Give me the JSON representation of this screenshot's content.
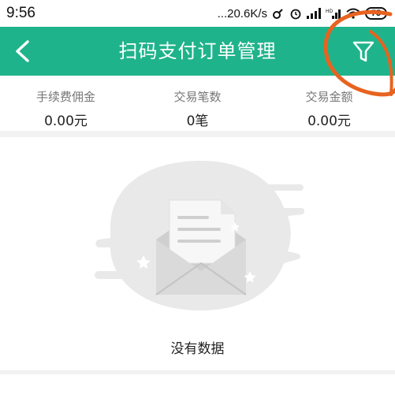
{
  "status_bar": {
    "time": "9:56",
    "network_speed": "...20.6K/s",
    "battery": "75"
  },
  "header": {
    "title": "扫码支付订单管理",
    "back_icon": "chevron-left-icon",
    "filter_icon": "filter-funnel-icon"
  },
  "stats": [
    {
      "label": "手续费佣金",
      "value": "0.00元"
    },
    {
      "label": "交易笔数",
      "value": "0笔"
    },
    {
      "label": "交易金额",
      "value": "0.00元"
    }
  ],
  "empty_state": {
    "icon": "empty-envelope-icon",
    "text": "没有数据"
  },
  "colors": {
    "header_bg": "#1fb38b",
    "annotation": "#e8631f"
  }
}
